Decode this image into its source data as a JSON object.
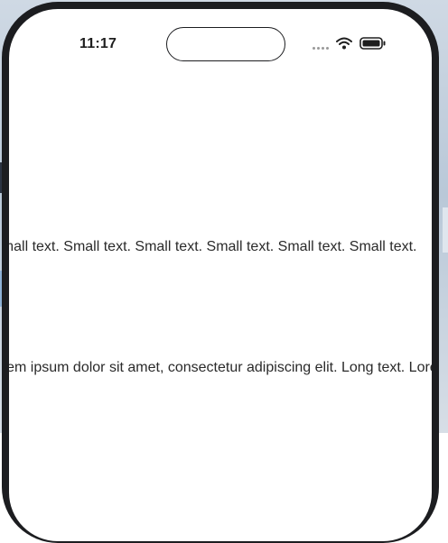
{
  "status_bar": {
    "time": "11:17"
  },
  "content": {
    "small_text_row": "Small text.  Small text.  Small text.  Small text.  Small text.  Small text.  Small text.",
    "long_text_row": "Lorem ipsum dolor sit amet, consectetur adipiscing elit.  Long text. Lorem ipsum dolor sit amet, consectetur adipiscing elit."
  },
  "icons": {
    "signal": "cellular-signal-icon",
    "wifi": "wifi-icon",
    "battery": "battery-icon"
  },
  "colors": {
    "device_frame": "#1c1d20",
    "screen_background": "#ffffff",
    "text": "#2a2a2a"
  }
}
